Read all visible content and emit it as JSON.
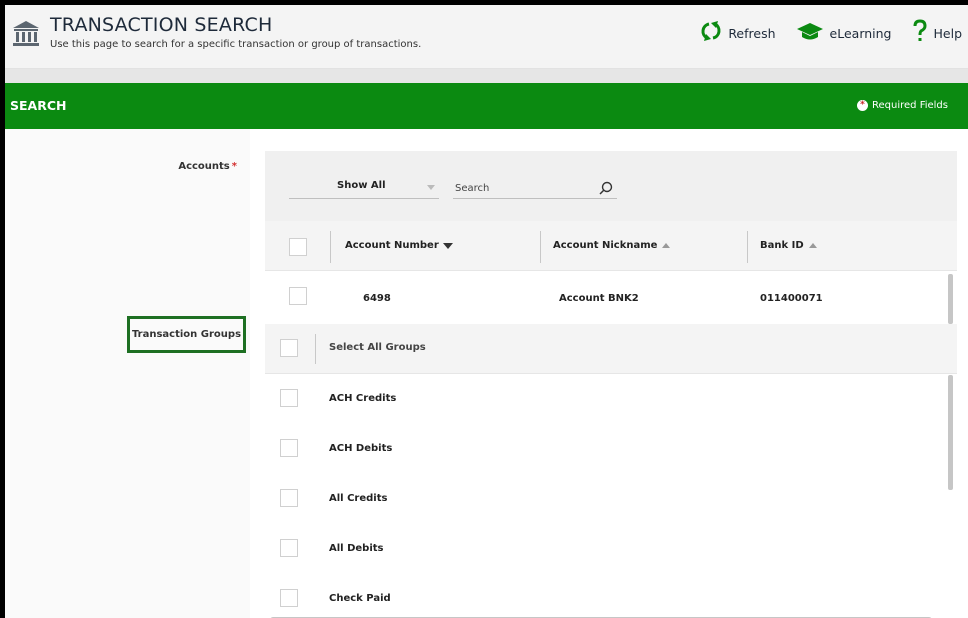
{
  "header": {
    "title": "TRANSACTION SEARCH",
    "subtitle": "Use this page to search for a specific transaction or group of transactions.",
    "actions": {
      "refresh": "Refresh",
      "elearning": "eLearning",
      "help": "Help"
    },
    "icons": [
      "bank-icon",
      "refresh-icon",
      "graduation-cap-icon",
      "question-mark-icon"
    ]
  },
  "section": {
    "title": "SEARCH",
    "required_label": "Required Fields",
    "required_marker": "*"
  },
  "labels": {
    "accounts": "Accounts",
    "accounts_required": "*",
    "transaction_groups": "Transaction Groups"
  },
  "accounts": {
    "filter": {
      "selected": "Show All",
      "search_placeholder": "Search"
    },
    "columns": [
      {
        "label": "Account Number",
        "sort": "desc"
      },
      {
        "label": "Account Nickname",
        "sort": "asc"
      },
      {
        "label": "Bank ID",
        "sort": "asc"
      }
    ],
    "rows": [
      {
        "account_number": "6498",
        "nickname": "Account BNK2",
        "bank_id": "011400071",
        "checked": false
      }
    ]
  },
  "transaction_groups": {
    "select_all_label": "Select All Groups",
    "items": [
      {
        "label": "ACH Credits",
        "checked": false
      },
      {
        "label": "ACH Debits",
        "checked": false
      },
      {
        "label": "All Credits",
        "checked": false
      },
      {
        "label": "All Debits",
        "checked": false
      },
      {
        "label": "Check Paid",
        "checked": false
      }
    ]
  },
  "colors": {
    "section_bar": "#0b8a11",
    "highlight_box": "#1d6f22",
    "required_star": "#d32f2f"
  }
}
